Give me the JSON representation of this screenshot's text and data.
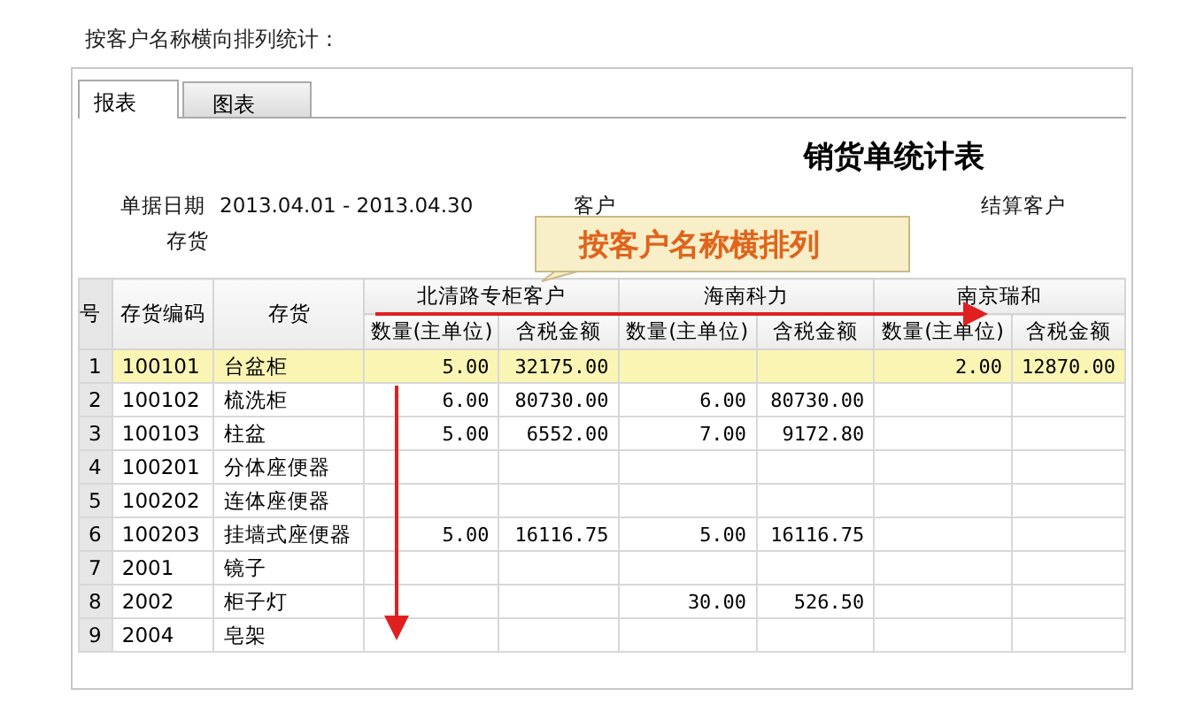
{
  "heading": "按客户名称横向排列统计：",
  "tabs": [
    {
      "label": "报表",
      "selected": true
    },
    {
      "label": "图表",
      "selected": false
    }
  ],
  "report": {
    "title": "销货单统计表",
    "date_label": "单据日期",
    "date_value": "2013.04.01 - 2013.04.30",
    "customer_label": "客户",
    "settle_label": "结算客户",
    "stock_label": "存货"
  },
  "callout": "按客户名称横排列",
  "table": {
    "fixed_columns": [
      "号",
      "存货编码",
      "存货"
    ],
    "groups": [
      {
        "name": "北清路专柜客户",
        "columns": [
          "数量(主单位)",
          "含税金额"
        ]
      },
      {
        "name": "海南科力",
        "columns": [
          "数量(主单位)",
          "含税金额"
        ]
      },
      {
        "name": "南京瑞和",
        "columns": [
          "数量(主单位)",
          "含税金额"
        ]
      }
    ],
    "rows": [
      {
        "selected": true,
        "cells": [
          "1",
          "100101",
          "台盆柜",
          "5.00",
          "32175.00",
          null,
          null,
          "2.00",
          "12870.00"
        ]
      },
      {
        "selected": false,
        "cells": [
          "2",
          "100102",
          "梳洗柜",
          "6.00",
          "80730.00",
          "6.00",
          "80730.00",
          null,
          null
        ]
      },
      {
        "selected": false,
        "cells": [
          "3",
          "100103",
          "柱盆",
          "5.00",
          "6552.00",
          "7.00",
          "9172.80",
          null,
          null
        ]
      },
      {
        "selected": false,
        "cells": [
          "4",
          "100201",
          "分体座便器",
          null,
          null,
          null,
          null,
          null,
          null
        ]
      },
      {
        "selected": false,
        "cells": [
          "5",
          "100202",
          "连体座便器",
          null,
          null,
          null,
          null,
          null,
          null
        ]
      },
      {
        "selected": false,
        "cells": [
          "6",
          "100203",
          "挂墙式座便器",
          "5.00",
          "16116.75",
          "5.00",
          "16116.75",
          null,
          null
        ]
      },
      {
        "selected": false,
        "cells": [
          "7",
          "2001",
          "镜子",
          null,
          null,
          null,
          null,
          null,
          null
        ]
      },
      {
        "selected": false,
        "cells": [
          "8",
          "2002",
          "柜子灯",
          null,
          null,
          "30.00",
          "526.50",
          null,
          null
        ]
      },
      {
        "selected": false,
        "cells": [
          "9",
          "2004",
          "皂架",
          null,
          null,
          null,
          null,
          null,
          null
        ]
      }
    ]
  }
}
